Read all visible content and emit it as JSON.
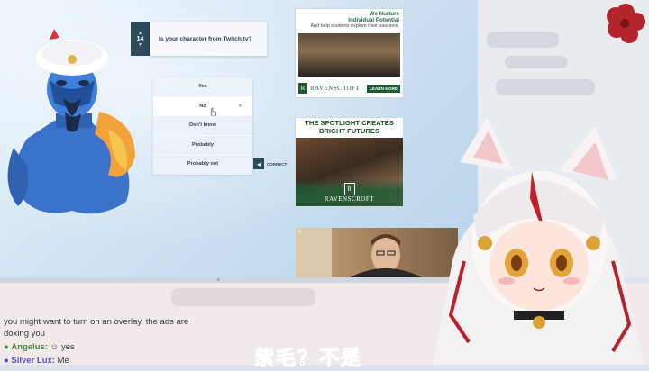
{
  "game": {
    "question_number": "14",
    "question_text": "Is your character from Twitch.tv?",
    "answers": [
      "Yes",
      "No",
      "Don't know",
      "Probably",
      "Probably not"
    ],
    "hovered_answer_index": 1,
    "correct_label": "CORRECT"
  },
  "ads": {
    "ad1": {
      "headline_line1": "We Nurture",
      "headline_line2": "Individual Potential",
      "subline": "And help students explore their passions.",
      "brand": "RAVENSCROFT",
      "button": "LEARN MORE"
    },
    "ad2": {
      "headline_line1": "THE SPOTLIGHT CREATES",
      "headline_line2": "BRIGHT FUTURES",
      "brand": "RAVENSCROFT"
    }
  },
  "chat": {
    "messages": [
      {
        "user": "",
        "text": "you might want to turn on an overlay, the ads are"
      },
      {
        "user": "",
        "text": "doxing you"
      },
      {
        "user": "Angelus:",
        "text": "yes",
        "user_color": "#4a8a3c"
      },
      {
        "user": "Silver Lux:",
        "text": "Me",
        "user_color": "#5a4fc0"
      }
    ]
  },
  "subtitle": "紫毛？不是",
  "colors": {
    "accent_dark": "#2c4a5a",
    "ad_green": "#1d5a34",
    "subtitle_purple": "#b98fd9",
    "chat_bg": "#f2e9ea"
  }
}
